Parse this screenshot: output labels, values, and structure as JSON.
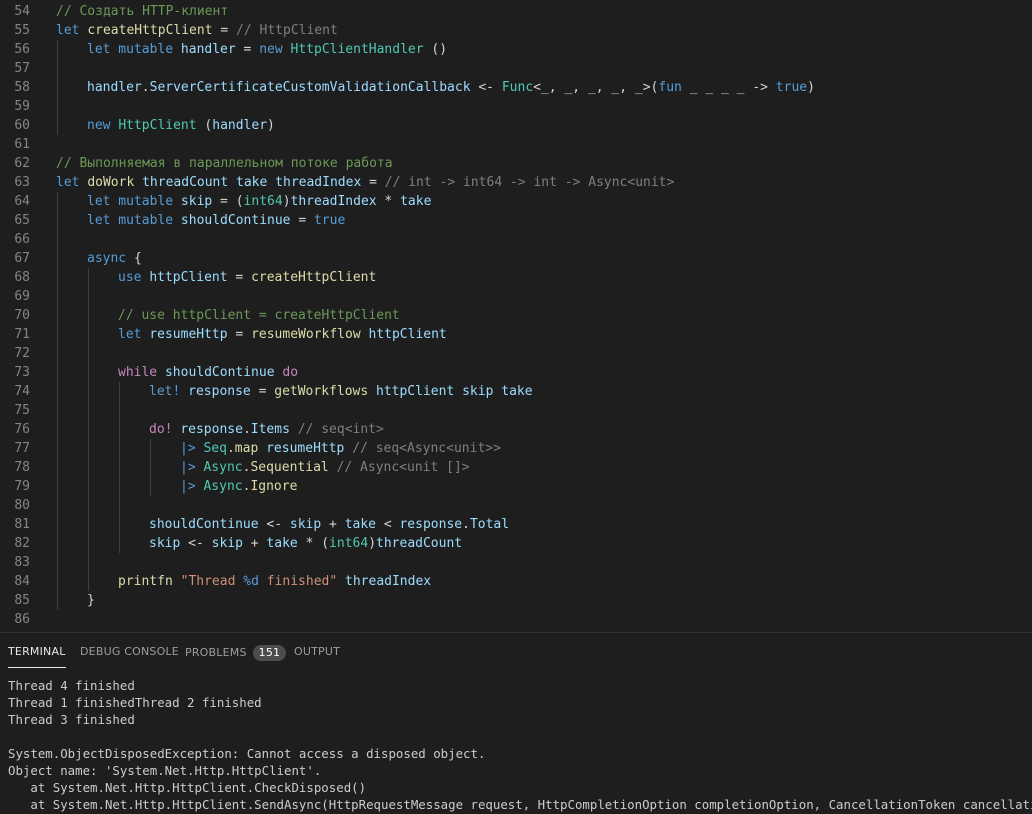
{
  "theme": {
    "background": "#1e1e1e",
    "comment": "#6a9955",
    "keyword": "#569cd6",
    "control": "#c586c0",
    "identifier": "#9cdcfe",
    "function": "#dcdcaa",
    "type": "#4ec9b0",
    "string": "#ce9178",
    "line_number": "#858585"
  },
  "editor": {
    "lines": [
      {
        "n": "54",
        "indent": 0,
        "tokens": [
          {
            "c": "comment",
            "t": "// Создать HTTP-клиент"
          }
        ]
      },
      {
        "n": "55",
        "indent": 0,
        "tokens": [
          {
            "c": "keyword",
            "t": "let "
          },
          {
            "c": "func",
            "t": "createHttpClient"
          },
          {
            "c": "plain",
            "t": " = "
          },
          {
            "c": "hint",
            "t": "// HttpClient"
          }
        ]
      },
      {
        "n": "56",
        "indent": 1,
        "tokens": [
          {
            "c": "keyword",
            "t": "let mutable "
          },
          {
            "c": "ident",
            "t": "handler"
          },
          {
            "c": "plain",
            "t": " = "
          },
          {
            "c": "keyword",
            "t": "new "
          },
          {
            "c": "type",
            "t": "HttpClientHandler"
          },
          {
            "c": "plain",
            "t": " ()"
          }
        ]
      },
      {
        "n": "57",
        "indent": 1,
        "tokens": []
      },
      {
        "n": "58",
        "indent": 1,
        "tokens": [
          {
            "c": "ident",
            "t": "handler"
          },
          {
            "c": "plain",
            "t": "."
          },
          {
            "c": "ident",
            "t": "ServerCertificateCustomValidationCallback"
          },
          {
            "c": "plain",
            "t": " <- "
          },
          {
            "c": "type",
            "t": "Func"
          },
          {
            "c": "plain",
            "t": "<_, _, _, _, _>("
          },
          {
            "c": "keyword",
            "t": "fun"
          },
          {
            "c": "plain",
            "t": " _ _ _ _ -> "
          },
          {
            "c": "keyword",
            "t": "true"
          },
          {
            "c": "plain",
            "t": ")"
          }
        ]
      },
      {
        "n": "59",
        "indent": 1,
        "tokens": []
      },
      {
        "n": "60",
        "indent": 1,
        "tokens": [
          {
            "c": "keyword",
            "t": "new "
          },
          {
            "c": "type",
            "t": "HttpClient"
          },
          {
            "c": "plain",
            "t": " ("
          },
          {
            "c": "ident",
            "t": "handler"
          },
          {
            "c": "plain",
            "t": ")"
          }
        ]
      },
      {
        "n": "61",
        "indent": 0,
        "tokens": []
      },
      {
        "n": "62",
        "indent": 0,
        "tokens": [
          {
            "c": "comment",
            "t": "// Выполняемая в параллельном потоке работа"
          }
        ]
      },
      {
        "n": "63",
        "indent": 0,
        "tokens": [
          {
            "c": "keyword",
            "t": "let "
          },
          {
            "c": "func",
            "t": "doWork"
          },
          {
            "c": "plain",
            "t": " "
          },
          {
            "c": "ident",
            "t": "threadCount"
          },
          {
            "c": "plain",
            "t": " "
          },
          {
            "c": "ident",
            "t": "take"
          },
          {
            "c": "plain",
            "t": " "
          },
          {
            "c": "ident",
            "t": "threadIndex"
          },
          {
            "c": "plain",
            "t": " = "
          },
          {
            "c": "hint",
            "t": "// int -> int64 -> int -> Async<unit>"
          }
        ]
      },
      {
        "n": "64",
        "indent": 1,
        "tokens": [
          {
            "c": "keyword",
            "t": "let mutable "
          },
          {
            "c": "ident",
            "t": "skip"
          },
          {
            "c": "plain",
            "t": " = ("
          },
          {
            "c": "type",
            "t": "int64"
          },
          {
            "c": "plain",
            "t": ")"
          },
          {
            "c": "ident",
            "t": "threadIndex"
          },
          {
            "c": "plain",
            "t": " * "
          },
          {
            "c": "ident",
            "t": "take"
          }
        ]
      },
      {
        "n": "65",
        "indent": 1,
        "tokens": [
          {
            "c": "keyword",
            "t": "let mutable "
          },
          {
            "c": "ident",
            "t": "shouldContinue"
          },
          {
            "c": "plain",
            "t": " = "
          },
          {
            "c": "keyword",
            "t": "true"
          }
        ]
      },
      {
        "n": "66",
        "indent": 1,
        "tokens": []
      },
      {
        "n": "67",
        "indent": 1,
        "tokens": [
          {
            "c": "keyword",
            "t": "async"
          },
          {
            "c": "plain",
            "t": " {"
          }
        ]
      },
      {
        "n": "68",
        "indent": 2,
        "tokens": [
          {
            "c": "keyword",
            "t": "use "
          },
          {
            "c": "ident",
            "t": "httpClient"
          },
          {
            "c": "plain",
            "t": " = "
          },
          {
            "c": "func",
            "t": "createHttpClient"
          }
        ]
      },
      {
        "n": "69",
        "indent": 2,
        "tokens": []
      },
      {
        "n": "70",
        "indent": 2,
        "tokens": [
          {
            "c": "comment",
            "t": "// use httpClient = createHttpClient"
          }
        ]
      },
      {
        "n": "71",
        "indent": 2,
        "tokens": [
          {
            "c": "keyword",
            "t": "let "
          },
          {
            "c": "ident",
            "t": "resumeHttp"
          },
          {
            "c": "plain",
            "t": " = "
          },
          {
            "c": "func",
            "t": "resumeWorkflow"
          },
          {
            "c": "plain",
            "t": " "
          },
          {
            "c": "ident",
            "t": "httpClient"
          }
        ]
      },
      {
        "n": "72",
        "indent": 2,
        "tokens": []
      },
      {
        "n": "73",
        "indent": 2,
        "tokens": [
          {
            "c": "control",
            "t": "while "
          },
          {
            "c": "ident",
            "t": "shouldContinue"
          },
          {
            "c": "plain",
            "t": " "
          },
          {
            "c": "control",
            "t": "do"
          }
        ]
      },
      {
        "n": "74",
        "indent": 3,
        "tokens": [
          {
            "c": "keyword",
            "t": "let! "
          },
          {
            "c": "ident",
            "t": "response"
          },
          {
            "c": "plain",
            "t": " = "
          },
          {
            "c": "func",
            "t": "getWorkflows"
          },
          {
            "c": "plain",
            "t": " "
          },
          {
            "c": "ident",
            "t": "httpClient"
          },
          {
            "c": "plain",
            "t": " "
          },
          {
            "c": "ident",
            "t": "skip"
          },
          {
            "c": "plain",
            "t": " "
          },
          {
            "c": "ident",
            "t": "take"
          }
        ]
      },
      {
        "n": "75",
        "indent": 3,
        "tokens": []
      },
      {
        "n": "76",
        "indent": 3,
        "tokens": [
          {
            "c": "control",
            "t": "do! "
          },
          {
            "c": "ident",
            "t": "response"
          },
          {
            "c": "plain",
            "t": "."
          },
          {
            "c": "ident",
            "t": "Items"
          },
          {
            "c": "plain",
            "t": " "
          },
          {
            "c": "hint",
            "t": "// seq<int>"
          }
        ]
      },
      {
        "n": "77",
        "indent": 4,
        "tokens": [
          {
            "c": "keyword",
            "t": "|>"
          },
          {
            "c": "plain",
            "t": " "
          },
          {
            "c": "type",
            "t": "Seq"
          },
          {
            "c": "plain",
            "t": "."
          },
          {
            "c": "func",
            "t": "map"
          },
          {
            "c": "plain",
            "t": " "
          },
          {
            "c": "ident",
            "t": "resumeHttp"
          },
          {
            "c": "plain",
            "t": " "
          },
          {
            "c": "hint",
            "t": "// seq<Async<unit>>"
          }
        ]
      },
      {
        "n": "78",
        "indent": 4,
        "tokens": [
          {
            "c": "keyword",
            "t": "|>"
          },
          {
            "c": "plain",
            "t": " "
          },
          {
            "c": "type",
            "t": "Async"
          },
          {
            "c": "plain",
            "t": "."
          },
          {
            "c": "func",
            "t": "Sequential"
          },
          {
            "c": "plain",
            "t": " "
          },
          {
            "c": "hint",
            "t": "// Async<unit []>"
          }
        ]
      },
      {
        "n": "79",
        "indent": 4,
        "tokens": [
          {
            "c": "keyword",
            "t": "|>"
          },
          {
            "c": "plain",
            "t": " "
          },
          {
            "c": "type",
            "t": "Async"
          },
          {
            "c": "plain",
            "t": "."
          },
          {
            "c": "func",
            "t": "Ignore"
          }
        ]
      },
      {
        "n": "80",
        "indent": 3,
        "tokens": []
      },
      {
        "n": "81",
        "indent": 3,
        "tokens": [
          {
            "c": "ident",
            "t": "shouldContinue"
          },
          {
            "c": "plain",
            "t": " <- "
          },
          {
            "c": "ident",
            "t": "skip"
          },
          {
            "c": "plain",
            "t": " + "
          },
          {
            "c": "ident",
            "t": "take"
          },
          {
            "c": "plain",
            "t": " < "
          },
          {
            "c": "ident",
            "t": "response"
          },
          {
            "c": "plain",
            "t": "."
          },
          {
            "c": "ident",
            "t": "Total"
          }
        ]
      },
      {
        "n": "82",
        "indent": 3,
        "tokens": [
          {
            "c": "ident",
            "t": "skip"
          },
          {
            "c": "plain",
            "t": " <- "
          },
          {
            "c": "ident",
            "t": "skip"
          },
          {
            "c": "plain",
            "t": " + "
          },
          {
            "c": "ident",
            "t": "take"
          },
          {
            "c": "plain",
            "t": " * ("
          },
          {
            "c": "type",
            "t": "int64"
          },
          {
            "c": "plain",
            "t": ")"
          },
          {
            "c": "ident",
            "t": "threadCount"
          }
        ]
      },
      {
        "n": "83",
        "indent": 2,
        "tokens": []
      },
      {
        "n": "84",
        "indent": 2,
        "tokens": [
          {
            "c": "func",
            "t": "printfn"
          },
          {
            "c": "plain",
            "t": " "
          },
          {
            "c": "string",
            "t": "\"Thread "
          },
          {
            "c": "keyword",
            "t": "%d"
          },
          {
            "c": "string",
            "t": " finished\""
          },
          {
            "c": "plain",
            "t": " "
          },
          {
            "c": "ident",
            "t": "threadIndex"
          }
        ]
      },
      {
        "n": "85",
        "indent": 1,
        "tokens": [
          {
            "c": "plain",
            "t": "}"
          }
        ]
      },
      {
        "n": "86",
        "indent": 0,
        "tokens": []
      }
    ]
  },
  "panel": {
    "tabs": {
      "terminal": "TERMINAL",
      "debug_console": "DEBUG CONSOLE",
      "problems": "PROBLEMS",
      "problems_count": "151",
      "output": "OUTPUT"
    },
    "terminal_lines": [
      "Thread 4 finished",
      "Thread 1 finishedThread 2 finished",
      "Thread 3 finished",
      "",
      "System.ObjectDisposedException: Cannot access a disposed object.",
      "Object name: 'System.Net.Http.HttpClient'.",
      "   at System.Net.Http.HttpClient.CheckDisposed()",
      "   at System.Net.Http.HttpClient.SendAsync(HttpRequestMessage request, HttpCompletionOption completionOption, CancellationToken cancellationToken)"
    ]
  }
}
